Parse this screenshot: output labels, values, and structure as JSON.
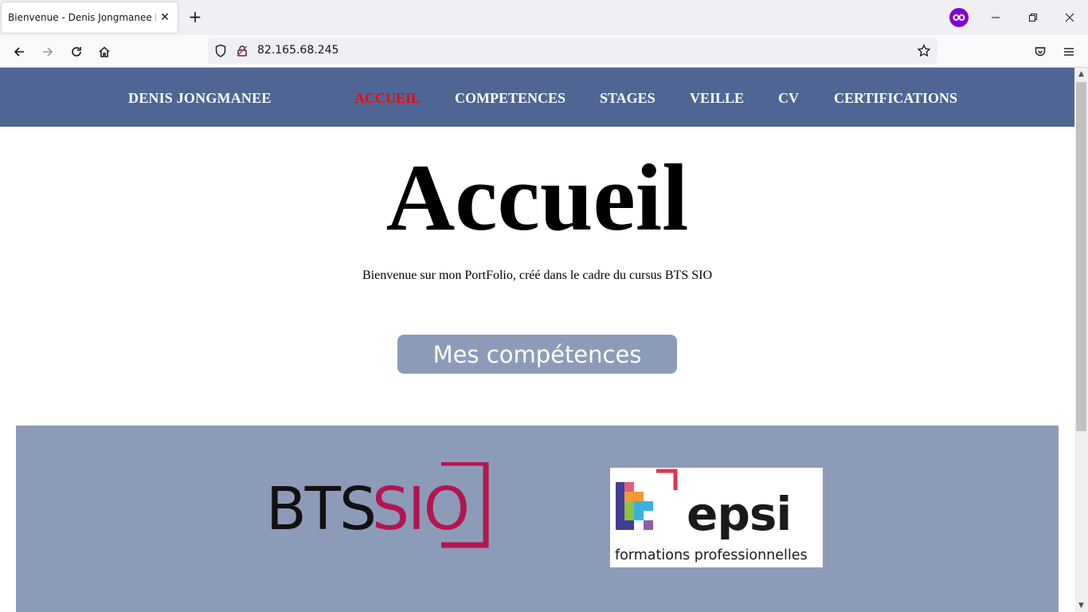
{
  "browser": {
    "tab_title": "Bienvenue - Denis Jongmanee Port",
    "url": "82.165.68.245"
  },
  "site": {
    "brand": "DENIS JONGMANEE",
    "menu": [
      {
        "label": "ACCUEIL",
        "active": true
      },
      {
        "label": "COMPETENCES",
        "active": false
      },
      {
        "label": "STAGES",
        "active": false
      },
      {
        "label": "VEILLE",
        "active": false
      },
      {
        "label": "CV",
        "active": false
      },
      {
        "label": "CERTIFICATIONS",
        "active": false
      }
    ],
    "colors": {
      "header_bg": "#4f6694",
      "active_menu": "#ff0000",
      "button_bg": "#8c9cb8",
      "logo_band_bg": "#8c9cb8"
    }
  },
  "hero": {
    "title": "Accueil",
    "subtitle": "Bienvenue sur mon PortFolio, créé dans le cadre du cursus BTS SIO",
    "button_label": "Mes compétences"
  },
  "logos": {
    "bts": {
      "text_black": "BTS",
      "text_red": "SIO"
    },
    "epsi": {
      "word": "epsi",
      "tagline": "formations professionnelles"
    }
  }
}
